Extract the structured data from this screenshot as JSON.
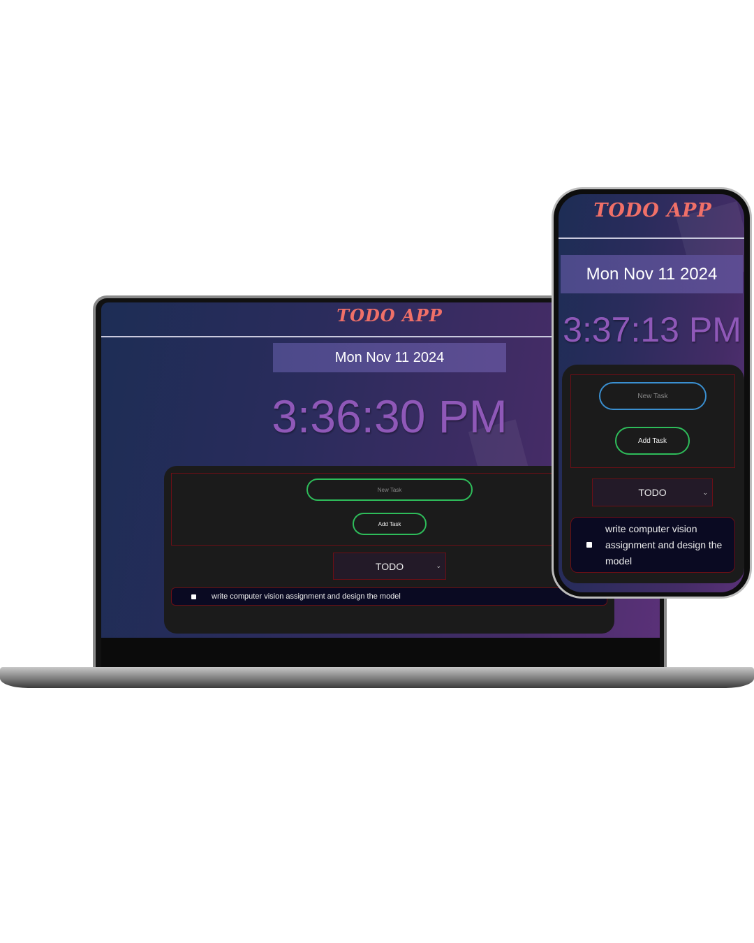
{
  "app": {
    "title": "TODO APP",
    "date": "Mon Nov 11 2024",
    "new_task_placeholder": "New Task",
    "add_task_label": "Add Task",
    "filter_selected": "TODO",
    "task_text": "write computer vision assignment and design the model"
  },
  "laptop": {
    "time": "3:36:30 PM"
  },
  "phone": {
    "time": "3:37:13 PM"
  },
  "colors": {
    "title": "#f07068",
    "time": "#8f58b8",
    "input_border_laptop": "#2ebc5a",
    "input_border_phone": "#3a8fd0",
    "button_border": "#2ebc5a",
    "red_outline": "#6b0f16"
  }
}
